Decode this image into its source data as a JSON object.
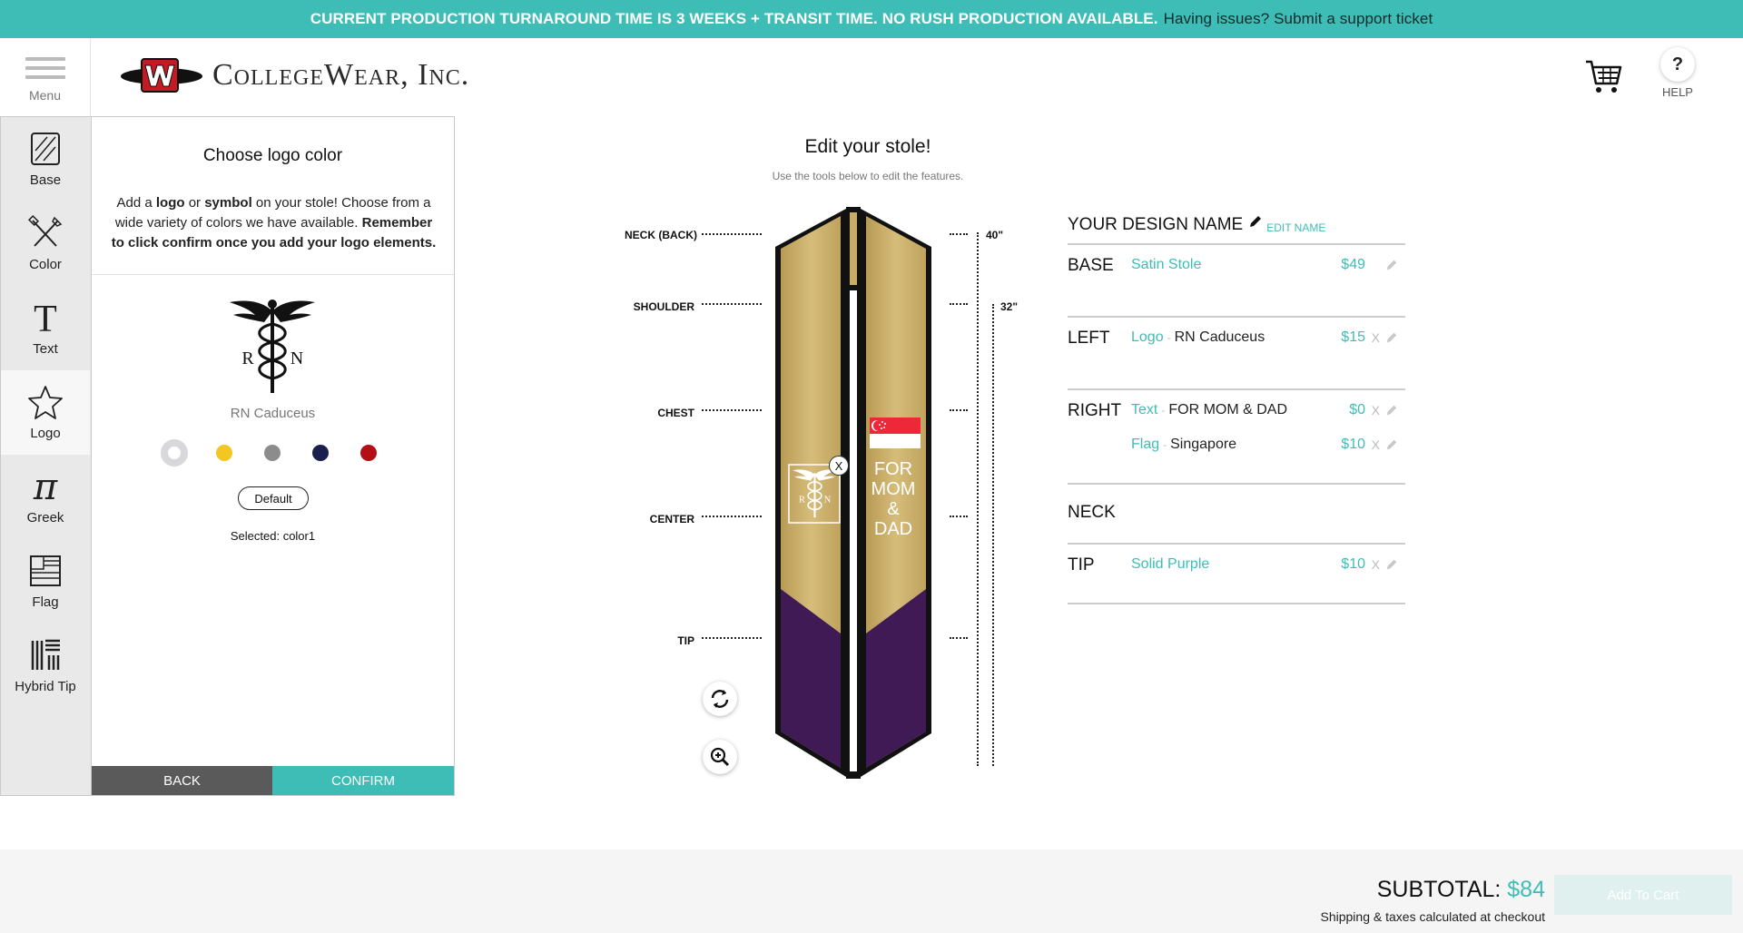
{
  "banner": {
    "notice": "CURRENT PRODUCTION TURNAROUND TIME IS 3 WEEKS + TRANSIT TIME. NO RUSH PRODUCTION AVAILABLE.",
    "support_link": "Having issues? Submit a support ticket"
  },
  "header": {
    "menu_label": "Menu",
    "brand": "CollegeWear, Inc.",
    "help_symbol": "?",
    "help_label": "HELP"
  },
  "tools": [
    {
      "label": "Base",
      "icon": "base-icon"
    },
    {
      "label": "Color",
      "icon": "color-icon"
    },
    {
      "label": "Text",
      "icon": "text-icon"
    },
    {
      "label": "Logo",
      "icon": "star-icon"
    },
    {
      "label": "Greek",
      "icon": "pi-icon"
    },
    {
      "label": "Flag",
      "icon": "flag-icon"
    },
    {
      "label": "Hybrid Tip",
      "icon": "hybrid-tip-icon"
    }
  ],
  "panel": {
    "title": "Choose logo color",
    "desc_1": "Add a ",
    "desc_logo": "logo",
    "desc_2": " or ",
    "desc_symbol": "symbol",
    "desc_3": " on your stole! Choose from a wide variety of colors we have available. ",
    "desc_remember": "Remember to click confirm once you add your logo elements.",
    "logo_name": "RN Caduceus",
    "logo_letters": [
      "R",
      "N"
    ],
    "swatches": [
      "#ffffff",
      "#f3c623",
      "#8c8c8c",
      "#1a1f4d",
      "#b30f16"
    ],
    "default_label": "Default",
    "selected_text": "Selected: color1",
    "back_label": "BACK",
    "confirm_label": "CONFIRM"
  },
  "stole": {
    "title": "Edit your stole!",
    "subtitle": "Use the tools below to edit the features.",
    "measure_labels": [
      "NECK (BACK)",
      "SHOULDER",
      "CHEST",
      "CENTER",
      "TIP"
    ],
    "length_labels": [
      "40\"",
      "32\""
    ],
    "right_text": [
      "FOR",
      "MOM",
      "&",
      "DAD"
    ],
    "remove_symbol": "X",
    "colors": {
      "base": "#c8ad68",
      "tip": "#3f1a55",
      "trim": "#111111"
    }
  },
  "summary": {
    "design_name": "YOUR DESIGN NAME",
    "edit_name": "EDIT NAME",
    "sections": [
      {
        "label": "BASE",
        "lines": [
          {
            "cat": "Satin Stole",
            "val": "",
            "price": "$49"
          }
        ]
      },
      {
        "label": "LEFT",
        "lines": [
          {
            "cat": "Logo",
            "val": "RN Caduceus",
            "price": "$15"
          }
        ]
      },
      {
        "label": "RIGHT",
        "lines": [
          {
            "cat": "Text",
            "val": "FOR MOM & DAD",
            "price": "$0"
          },
          {
            "cat": "Flag",
            "val": "Singapore",
            "price": "$10"
          }
        ]
      },
      {
        "label": "NECK",
        "lines": []
      },
      {
        "label": "TIP",
        "lines": [
          {
            "cat": "Solid Purple",
            "val": "",
            "price": "$10"
          }
        ]
      }
    ],
    "line_sep": "-",
    "remove_symbol": "X"
  },
  "footer": {
    "subtotal_label": "SUBTOTAL:",
    "subtotal_amount": "$84",
    "shipping_note": "Shipping & taxes calculated at checkout",
    "add_to_cart": "Add To Cart"
  },
  "colors": {
    "accent": "#3dbdb6",
    "back": "#5a5a5a"
  }
}
